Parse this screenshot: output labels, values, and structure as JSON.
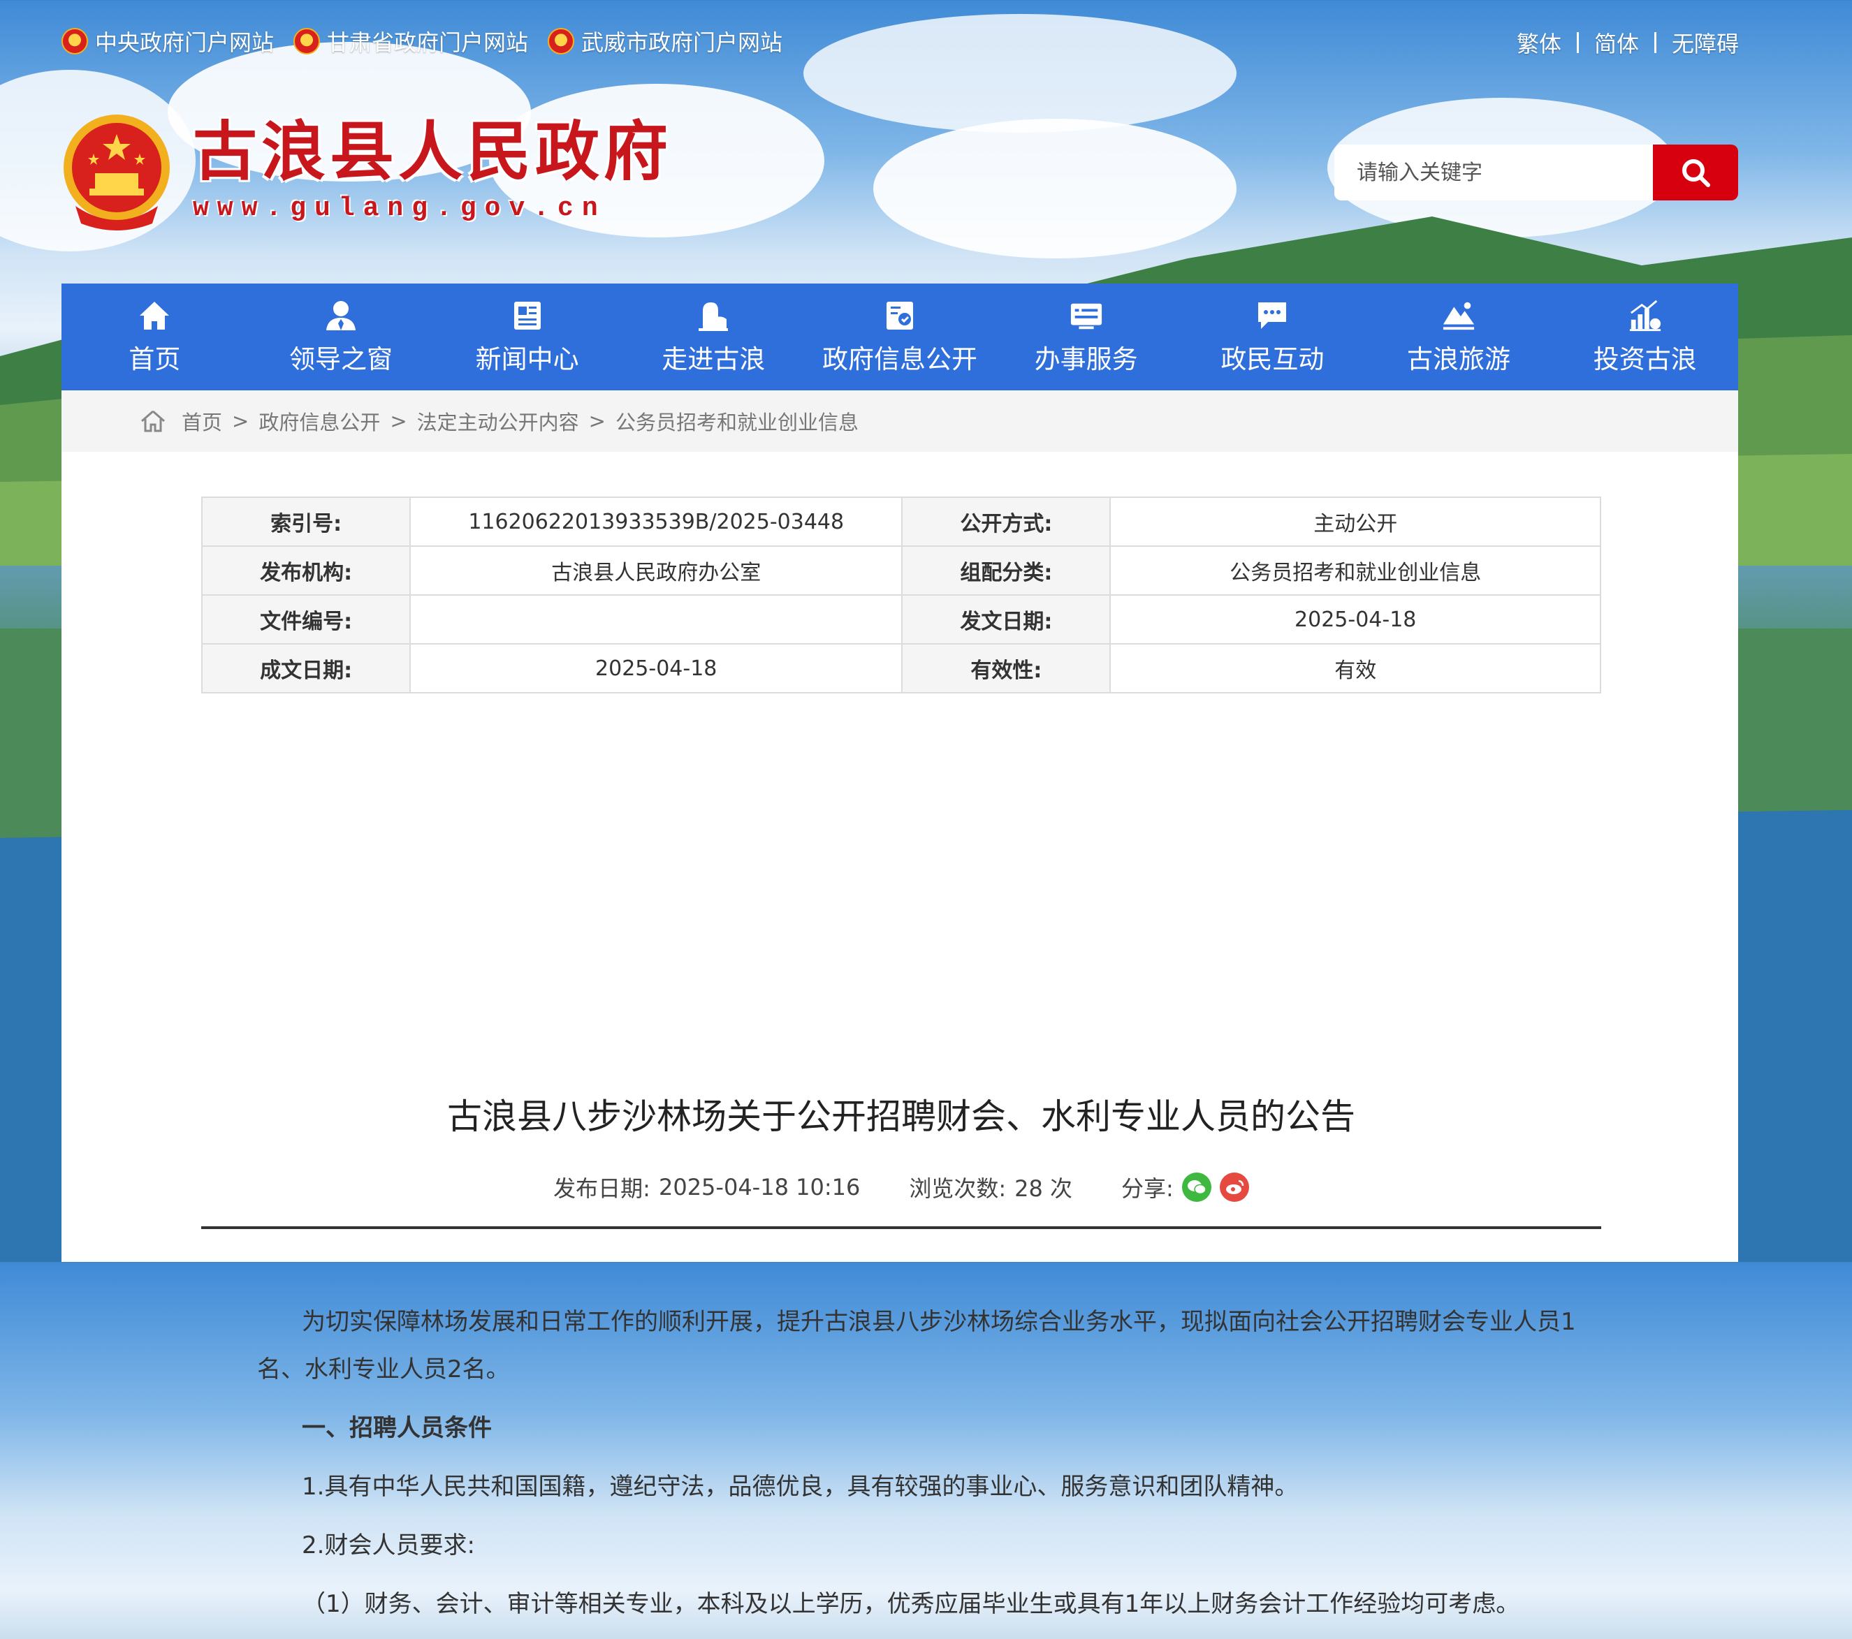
{
  "top_links": [
    {
      "label": "中央政府门户网站"
    },
    {
      "label": "甘肃省政府门户网站"
    },
    {
      "label": "武威市政府门户网站"
    }
  ],
  "lang": {
    "traditional": "繁体",
    "simplified": "简体",
    "accessible": "无障碍"
  },
  "site": {
    "title": "古浪县人民政府",
    "url": "www.gulang.gov.cn"
  },
  "search": {
    "placeholder": "请输入关键字"
  },
  "nav": [
    {
      "label": "首页",
      "icon": "home-icon"
    },
    {
      "label": "领导之窗",
      "icon": "leader-icon"
    },
    {
      "label": "新闻中心",
      "icon": "news-icon"
    },
    {
      "label": "走进古浪",
      "icon": "landmark-icon"
    },
    {
      "label": "政府信息公开",
      "icon": "info-disclosure-icon"
    },
    {
      "label": "办事服务",
      "icon": "service-icon"
    },
    {
      "label": "政民互动",
      "icon": "chat-icon"
    },
    {
      "label": "古浪旅游",
      "icon": "tourism-icon"
    },
    {
      "label": "投资古浪",
      "icon": "investment-icon"
    }
  ],
  "breadcrumb": [
    "首页",
    "政府信息公开",
    "法定主动公开内容",
    "公务员招考和就业创业信息"
  ],
  "info": {
    "index_label": "索引号:",
    "index_value": "11620622013933539B/2025-03448",
    "mode_label": "公开方式:",
    "mode_value": "主动公开",
    "publisher_label": "发布机构:",
    "publisher_value": "古浪县人民政府办公室",
    "category_label": "组配分类:",
    "category_value": "公务员招考和就业创业信息",
    "doc_no_label": "文件编号:",
    "doc_no_value": "",
    "issue_date_label": "发文日期:",
    "issue_date_value": "2025-04-18",
    "written_date_label": "成文日期:",
    "written_date_value": "2025-04-18",
    "validity_label": "有效性:",
    "validity_value": "有效"
  },
  "article": {
    "title": "古浪县八步沙林场关于公开招聘财会、水利专业人员的公告",
    "date_label": "发布日期:",
    "date_value": "2025-04-18 10:16",
    "views_label": "浏览次数:",
    "views_value": "28 次",
    "share_label": "分享:",
    "paragraphs": [
      "为切实保障林场发展和日常工作的顺利开展，提升古浪县八步沙林场综合业务水平，现拟面向社会公开招聘财会专业人员1名、水利专业人员2名。",
      "一、招聘人员条件",
      "1.具有中华人民共和国国籍，遵纪守法，品德优良，具有较强的事业心、服务意识和团队精神。",
      "2.财会人员要求:",
      "（1）财务、会计、审计等相关专业，本科及以上学历，优秀应届毕业生或具有1年以上财务会计工作经验均可考虑。"
    ]
  },
  "colors": {
    "nav": "#2f6fdc",
    "brand_red": "#c8161d",
    "search_btn": "#d7000f"
  }
}
